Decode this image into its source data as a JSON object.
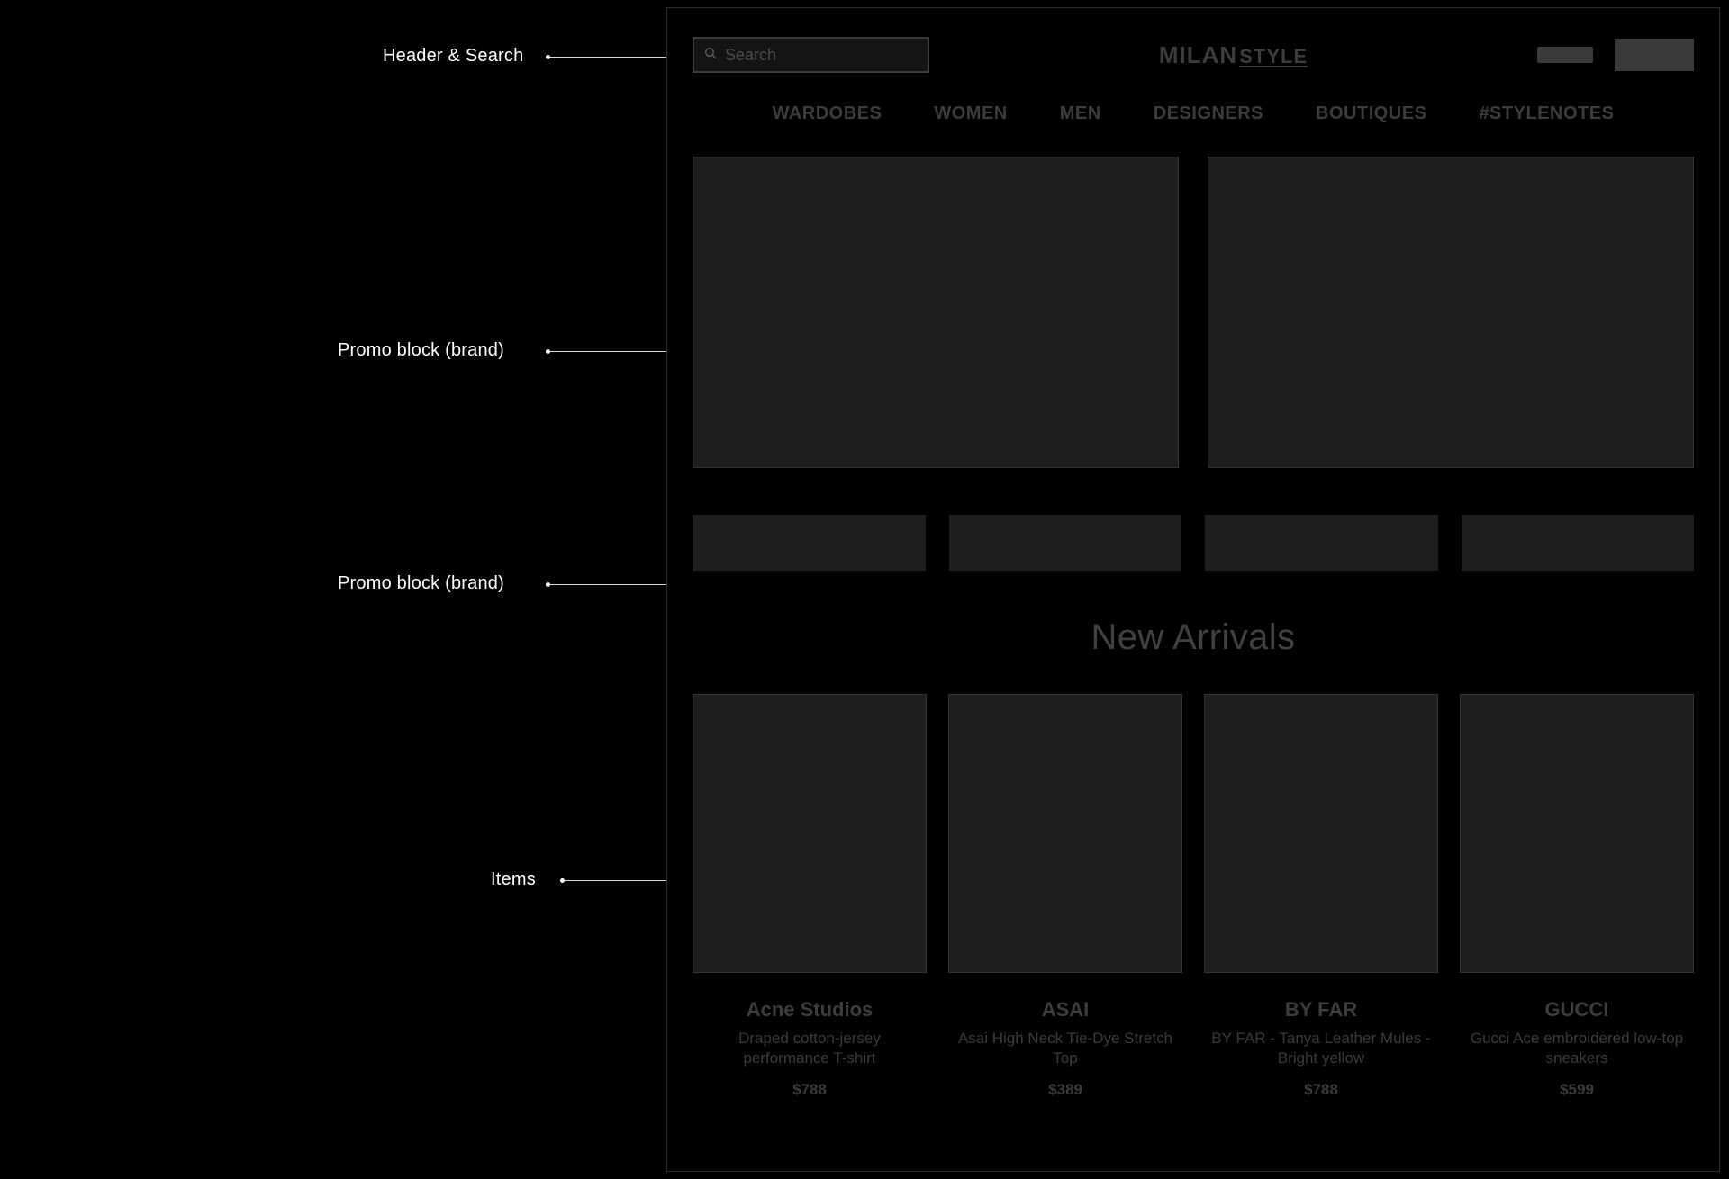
{
  "annotations": {
    "a1": "Header & Search",
    "a2": "Promo block (brand)",
    "a3": "Promo block (brand)",
    "a4": "Items"
  },
  "header": {
    "search_placeholder": "Search",
    "logo_part1": "MILAN",
    "logo_part2": "STYLE"
  },
  "nav": {
    "items": [
      {
        "label": "WARDOBES"
      },
      {
        "label": "WOMEN"
      },
      {
        "label": "MEN"
      },
      {
        "label": "DESIGNERS"
      },
      {
        "label": "BOUTIQUES"
      },
      {
        "label": "#STYLENOTES"
      }
    ]
  },
  "section": {
    "new_arrivals_title": "New Arrivals"
  },
  "products": [
    {
      "brand": "Acne Studios",
      "name": "Draped cotton-jersey performance T-shirt",
      "price": "$788"
    },
    {
      "brand": "ASAI",
      "name": "Asai High Neck Tie-Dye Stretch Top",
      "price": "$389"
    },
    {
      "brand": "BY FAR",
      "name": "BY FAR - Tanya Leather Mules - Bright yellow",
      "price": "$788"
    },
    {
      "brand": "GUCCI",
      "name": "Gucci Ace embroidered low-top sneakers",
      "price": "$599"
    }
  ]
}
